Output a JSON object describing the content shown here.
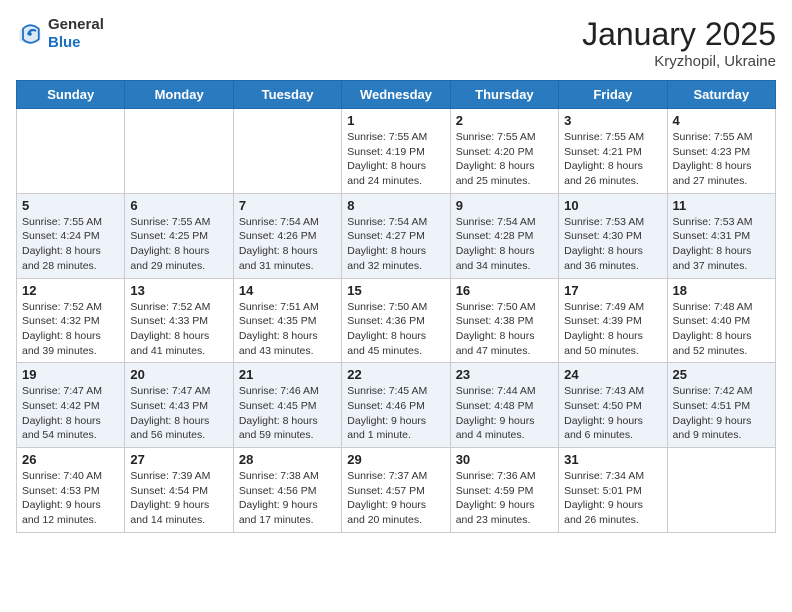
{
  "header": {
    "logo_line1": "General",
    "logo_line2": "Blue",
    "month": "January 2025",
    "location": "Kryzhopil, Ukraine"
  },
  "weekdays": [
    "Sunday",
    "Monday",
    "Tuesday",
    "Wednesday",
    "Thursday",
    "Friday",
    "Saturday"
  ],
  "weeks": [
    [
      {
        "day": "",
        "sunrise": "",
        "sunset": "",
        "daylight": ""
      },
      {
        "day": "",
        "sunrise": "",
        "sunset": "",
        "daylight": ""
      },
      {
        "day": "",
        "sunrise": "",
        "sunset": "",
        "daylight": ""
      },
      {
        "day": "1",
        "sunrise": "Sunrise: 7:55 AM",
        "sunset": "Sunset: 4:19 PM",
        "daylight": "Daylight: 8 hours and 24 minutes."
      },
      {
        "day": "2",
        "sunrise": "Sunrise: 7:55 AM",
        "sunset": "Sunset: 4:20 PM",
        "daylight": "Daylight: 8 hours and 25 minutes."
      },
      {
        "day": "3",
        "sunrise": "Sunrise: 7:55 AM",
        "sunset": "Sunset: 4:21 PM",
        "daylight": "Daylight: 8 hours and 26 minutes."
      },
      {
        "day": "4",
        "sunrise": "Sunrise: 7:55 AM",
        "sunset": "Sunset: 4:23 PM",
        "daylight": "Daylight: 8 hours and 27 minutes."
      }
    ],
    [
      {
        "day": "5",
        "sunrise": "Sunrise: 7:55 AM",
        "sunset": "Sunset: 4:24 PM",
        "daylight": "Daylight: 8 hours and 28 minutes."
      },
      {
        "day": "6",
        "sunrise": "Sunrise: 7:55 AM",
        "sunset": "Sunset: 4:25 PM",
        "daylight": "Daylight: 8 hours and 29 minutes."
      },
      {
        "day": "7",
        "sunrise": "Sunrise: 7:54 AM",
        "sunset": "Sunset: 4:26 PM",
        "daylight": "Daylight: 8 hours and 31 minutes."
      },
      {
        "day": "8",
        "sunrise": "Sunrise: 7:54 AM",
        "sunset": "Sunset: 4:27 PM",
        "daylight": "Daylight: 8 hours and 32 minutes."
      },
      {
        "day": "9",
        "sunrise": "Sunrise: 7:54 AM",
        "sunset": "Sunset: 4:28 PM",
        "daylight": "Daylight: 8 hours and 34 minutes."
      },
      {
        "day": "10",
        "sunrise": "Sunrise: 7:53 AM",
        "sunset": "Sunset: 4:30 PM",
        "daylight": "Daylight: 8 hours and 36 minutes."
      },
      {
        "day": "11",
        "sunrise": "Sunrise: 7:53 AM",
        "sunset": "Sunset: 4:31 PM",
        "daylight": "Daylight: 8 hours and 37 minutes."
      }
    ],
    [
      {
        "day": "12",
        "sunrise": "Sunrise: 7:52 AM",
        "sunset": "Sunset: 4:32 PM",
        "daylight": "Daylight: 8 hours and 39 minutes."
      },
      {
        "day": "13",
        "sunrise": "Sunrise: 7:52 AM",
        "sunset": "Sunset: 4:33 PM",
        "daylight": "Daylight: 8 hours and 41 minutes."
      },
      {
        "day": "14",
        "sunrise": "Sunrise: 7:51 AM",
        "sunset": "Sunset: 4:35 PM",
        "daylight": "Daylight: 8 hours and 43 minutes."
      },
      {
        "day": "15",
        "sunrise": "Sunrise: 7:50 AM",
        "sunset": "Sunset: 4:36 PM",
        "daylight": "Daylight: 8 hours and 45 minutes."
      },
      {
        "day": "16",
        "sunrise": "Sunrise: 7:50 AM",
        "sunset": "Sunset: 4:38 PM",
        "daylight": "Daylight: 8 hours and 47 minutes."
      },
      {
        "day": "17",
        "sunrise": "Sunrise: 7:49 AM",
        "sunset": "Sunset: 4:39 PM",
        "daylight": "Daylight: 8 hours and 50 minutes."
      },
      {
        "day": "18",
        "sunrise": "Sunrise: 7:48 AM",
        "sunset": "Sunset: 4:40 PM",
        "daylight": "Daylight: 8 hours and 52 minutes."
      }
    ],
    [
      {
        "day": "19",
        "sunrise": "Sunrise: 7:47 AM",
        "sunset": "Sunset: 4:42 PM",
        "daylight": "Daylight: 8 hours and 54 minutes."
      },
      {
        "day": "20",
        "sunrise": "Sunrise: 7:47 AM",
        "sunset": "Sunset: 4:43 PM",
        "daylight": "Daylight: 8 hours and 56 minutes."
      },
      {
        "day": "21",
        "sunrise": "Sunrise: 7:46 AM",
        "sunset": "Sunset: 4:45 PM",
        "daylight": "Daylight: 8 hours and 59 minutes."
      },
      {
        "day": "22",
        "sunrise": "Sunrise: 7:45 AM",
        "sunset": "Sunset: 4:46 PM",
        "daylight": "Daylight: 9 hours and 1 minute."
      },
      {
        "day": "23",
        "sunrise": "Sunrise: 7:44 AM",
        "sunset": "Sunset: 4:48 PM",
        "daylight": "Daylight: 9 hours and 4 minutes."
      },
      {
        "day": "24",
        "sunrise": "Sunrise: 7:43 AM",
        "sunset": "Sunset: 4:50 PM",
        "daylight": "Daylight: 9 hours and 6 minutes."
      },
      {
        "day": "25",
        "sunrise": "Sunrise: 7:42 AM",
        "sunset": "Sunset: 4:51 PM",
        "daylight": "Daylight: 9 hours and 9 minutes."
      }
    ],
    [
      {
        "day": "26",
        "sunrise": "Sunrise: 7:40 AM",
        "sunset": "Sunset: 4:53 PM",
        "daylight": "Daylight: 9 hours and 12 minutes."
      },
      {
        "day": "27",
        "sunrise": "Sunrise: 7:39 AM",
        "sunset": "Sunset: 4:54 PM",
        "daylight": "Daylight: 9 hours and 14 minutes."
      },
      {
        "day": "28",
        "sunrise": "Sunrise: 7:38 AM",
        "sunset": "Sunset: 4:56 PM",
        "daylight": "Daylight: 9 hours and 17 minutes."
      },
      {
        "day": "29",
        "sunrise": "Sunrise: 7:37 AM",
        "sunset": "Sunset: 4:57 PM",
        "daylight": "Daylight: 9 hours and 20 minutes."
      },
      {
        "day": "30",
        "sunrise": "Sunrise: 7:36 AM",
        "sunset": "Sunset: 4:59 PM",
        "daylight": "Daylight: 9 hours and 23 minutes."
      },
      {
        "day": "31",
        "sunrise": "Sunrise: 7:34 AM",
        "sunset": "Sunset: 5:01 PM",
        "daylight": "Daylight: 9 hours and 26 minutes."
      },
      {
        "day": "",
        "sunrise": "",
        "sunset": "",
        "daylight": ""
      }
    ]
  ]
}
